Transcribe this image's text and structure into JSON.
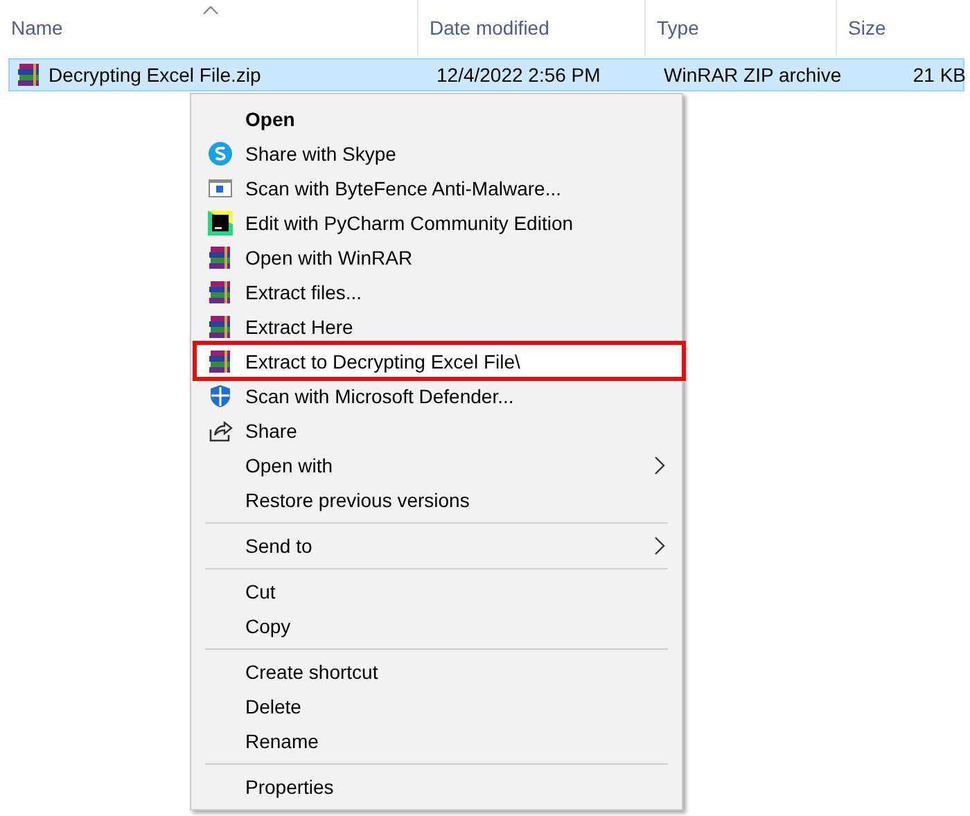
{
  "columns": [
    {
      "label": "Name",
      "sorted": true
    },
    {
      "label": "Date modified",
      "sorted": false
    },
    {
      "label": "Type",
      "sorted": false
    },
    {
      "label": "Size",
      "sorted": false
    }
  ],
  "file": {
    "selected": true,
    "name": "Decrypting Excel File.zip",
    "date": "12/4/2022 2:56 PM",
    "type": "WinRAR ZIP archive",
    "size": "21 KB"
  },
  "menu": [
    {
      "kind": "item",
      "label": "Open",
      "bold": true,
      "submenu": false,
      "selected": false,
      "callout": false
    },
    {
      "kind": "item",
      "label": "Share with Skype",
      "bold": false,
      "submenu": false,
      "selected": false,
      "callout": false
    },
    {
      "kind": "item",
      "label": "Scan with ByteFence Anti-Malware...",
      "bold": false,
      "submenu": false,
      "selected": false,
      "callout": false
    },
    {
      "kind": "item",
      "label": "Edit with PyCharm Community Edition",
      "bold": false,
      "submenu": false,
      "selected": false,
      "callout": false
    },
    {
      "kind": "item",
      "label": "Open with WinRAR",
      "bold": false,
      "submenu": false,
      "selected": false,
      "callout": false
    },
    {
      "kind": "item",
      "label": "Extract files...",
      "bold": false,
      "submenu": false,
      "selected": false,
      "callout": false
    },
    {
      "kind": "item",
      "label": "Extract Here",
      "bold": false,
      "submenu": false,
      "selected": false,
      "callout": false
    },
    {
      "kind": "item",
      "label": "Extract to Decrypting Excel File\\",
      "bold": false,
      "submenu": false,
      "selected": true,
      "callout": true
    },
    {
      "kind": "item",
      "label": "Scan with Microsoft Defender...",
      "bold": false,
      "submenu": false,
      "selected": false,
      "callout": false
    },
    {
      "kind": "item",
      "label": "Share",
      "bold": false,
      "submenu": false,
      "selected": false,
      "callout": false
    },
    {
      "kind": "item",
      "label": "Open with",
      "bold": false,
      "submenu": true,
      "selected": false,
      "callout": false
    },
    {
      "kind": "item",
      "label": "Restore previous versions",
      "bold": false,
      "submenu": false,
      "selected": false,
      "callout": false
    },
    {
      "kind": "separator"
    },
    {
      "kind": "item",
      "label": "Send to",
      "bold": false,
      "submenu": true,
      "selected": false,
      "callout": false
    },
    {
      "kind": "separator"
    },
    {
      "kind": "item",
      "label": "Cut",
      "bold": false,
      "submenu": false,
      "selected": false,
      "callout": false
    },
    {
      "kind": "item",
      "label": "Copy",
      "bold": false,
      "submenu": false,
      "selected": false,
      "callout": false
    },
    {
      "kind": "separator"
    },
    {
      "kind": "item",
      "label": "Create shortcut",
      "bold": false,
      "submenu": false,
      "selected": false,
      "callout": false
    },
    {
      "kind": "item",
      "label": "Delete",
      "bold": false,
      "submenu": false,
      "selected": false,
      "callout": false
    },
    {
      "kind": "item",
      "label": "Rename",
      "bold": false,
      "submenu": false,
      "selected": false,
      "callout": false
    },
    {
      "kind": "separator"
    },
    {
      "kind": "item",
      "label": "Properties",
      "bold": false,
      "submenu": false,
      "selected": false,
      "callout": false
    }
  ]
}
